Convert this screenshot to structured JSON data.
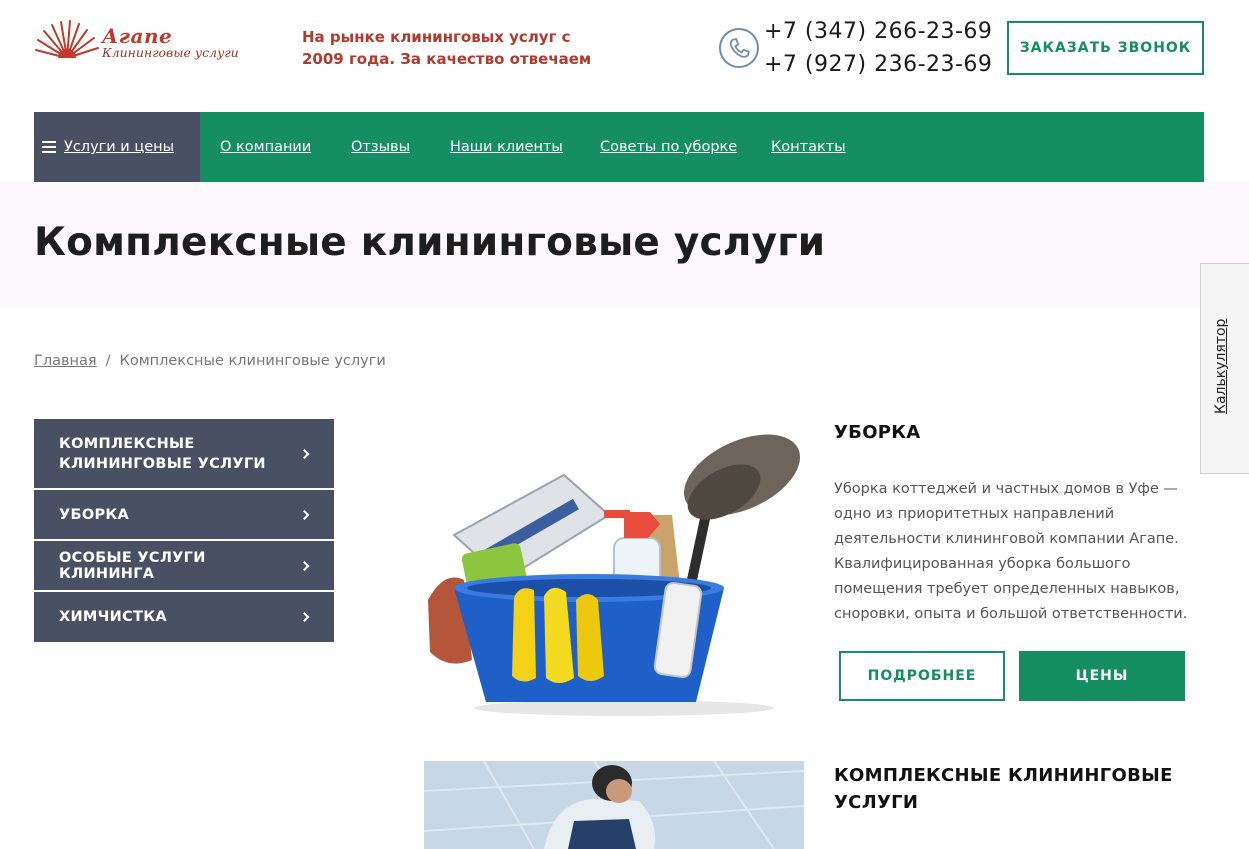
{
  "header": {
    "logo_title": "Агапе",
    "logo_subtitle": "Клининговые услуги",
    "tagline": "На рынке клининговых услуг с 2009 года. За качество отвечаем",
    "phones": [
      "+7 (347) 266-23-69",
      "+7 (927) 236-23-69"
    ],
    "callback_label": "ЗАКАЗАТЬ ЗВОНОК"
  },
  "nav": {
    "services_label": "Услуги и цены",
    "links": [
      "О компании",
      "Отзывы",
      "Наши клиенты",
      "Советы по уборке",
      "Контакты"
    ]
  },
  "page_title": "Комплексные клининговые услуги",
  "calculator_label": "Калькулятор",
  "breadcrumb": {
    "home": "Главная",
    "separator": "/",
    "current": "Комплексные клининговые услуги"
  },
  "sidebar": {
    "items": [
      "КОМПЛЕКСНЫЕ КЛИНИНГОВЫЕ УСЛУГИ",
      "УБОРКА",
      "ОСОБЫЕ УСЛУГИ КЛИНИНГА",
      "ХИМЧИСТКА"
    ]
  },
  "cards": [
    {
      "title": "УБОРКА",
      "text": "Уборка коттеджей и частных домов в Уфе — одно из приоритетных направлений деятельности клининговой компании Агапе. Квалифицированная уборка большого помещения требует определенных навыков, сноровки, опыта и большой ответственности.",
      "more_label": "ПОДРОБНЕЕ",
      "prices_label": "ЦЕНЫ"
    },
    {
      "title": "КОМПЛЕКСНЫЕ КЛИНИНГОВЫЕ УСЛУГИ"
    }
  ],
  "colors": {
    "green": "#158e61",
    "slate": "#4a5063",
    "brand_red": "#b03a2e"
  }
}
